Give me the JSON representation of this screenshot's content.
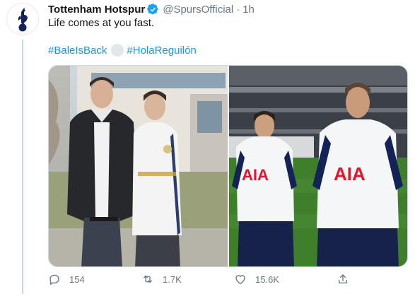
{
  "tweet": {
    "display_name": "Tottenham Hotspur",
    "handle": "@SpursOfficial",
    "separator": "·",
    "time": "1h",
    "text": "Life comes at you fast.",
    "hashtags": [
      "#BaleIsBack",
      "#HolaReguilón"
    ],
    "verified": true
  },
  "media": {
    "left_photo": {
      "jersey_text": ""
    },
    "right_photo": {
      "sponsor_text": "AIA"
    }
  },
  "actions": {
    "reply_count": "154",
    "retweet_count": "1.7K",
    "like_count": "15.6K"
  },
  "icons": {
    "avatar": "spurs-cockerel-icon",
    "verified": "verified-badge-icon",
    "reply": "reply-icon",
    "retweet": "retweet-icon",
    "like": "heart-icon",
    "share": "share-icon"
  },
  "colors": {
    "link": "#1b95e0",
    "verified": "#1da1f2",
    "muted": "#657786",
    "spurs_navy": "#132257"
  }
}
